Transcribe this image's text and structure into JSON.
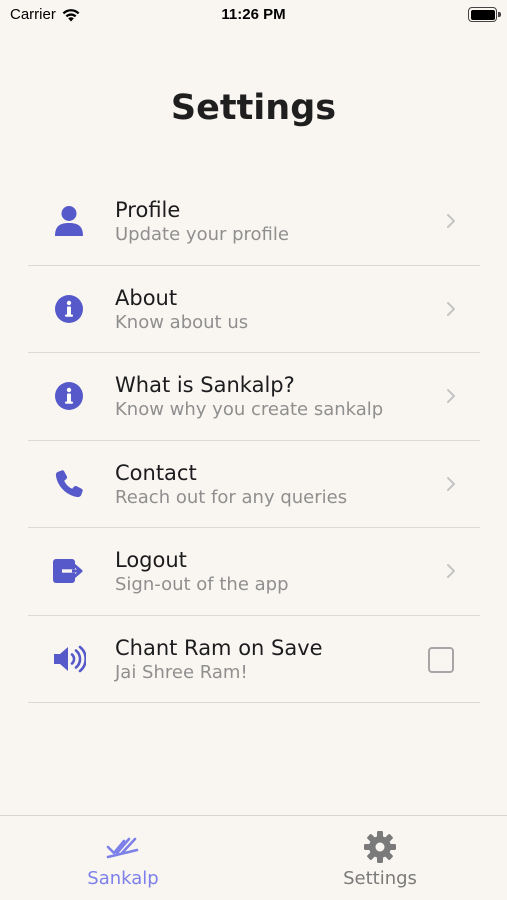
{
  "status_bar": {
    "carrier": "Carrier",
    "time": "11:26 PM",
    "battery_level": 1.0
  },
  "page": {
    "title": "Settings"
  },
  "settings": {
    "items": [
      {
        "title": "Profile",
        "subtitle": "Update your profile",
        "icon": "person-icon",
        "accessory": "chevron"
      },
      {
        "title": "About",
        "subtitle": "Know about us",
        "icon": "info-circle-icon",
        "accessory": "chevron"
      },
      {
        "title": "What is Sankalp?",
        "subtitle": "Know why you create sankalp",
        "icon": "info-circle-icon",
        "accessory": "chevron"
      },
      {
        "title": "Contact",
        "subtitle": "Reach out for any queries",
        "icon": "phone-icon",
        "accessory": "chevron"
      },
      {
        "title": "Logout",
        "subtitle": "Sign-out of the app",
        "icon": "logout-icon",
        "accessory": "chevron"
      },
      {
        "title": "Chant Ram on Save",
        "subtitle": "Jai Shree Ram!",
        "icon": "volume-icon",
        "accessory": "checkbox",
        "checked": false
      }
    ]
  },
  "tab_bar": {
    "tabs": [
      {
        "label": "Sankalp",
        "icon": "double-check-icon",
        "active": true
      },
      {
        "label": "Settings",
        "icon": "gear-icon",
        "active": false
      }
    ]
  },
  "colors": {
    "background": "#f9f6f1",
    "icon_accent": "#5659c9",
    "active_tab": "#7c80e8",
    "inactive_tab": "#7a7a7a",
    "subtitle": "#8f8f8f",
    "divider": "#dddad5"
  }
}
